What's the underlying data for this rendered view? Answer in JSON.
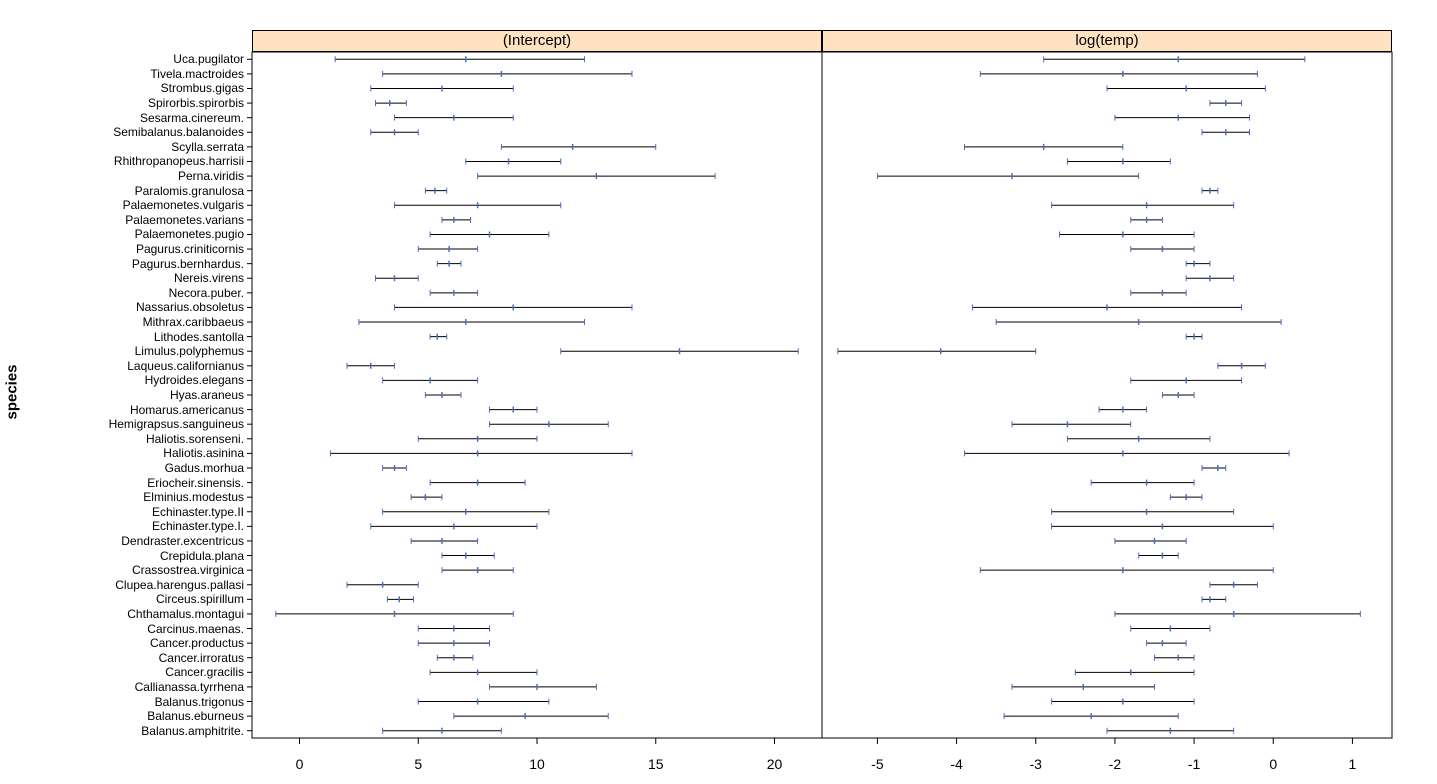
{
  "ylabel": "species",
  "chart_data": [
    {
      "type": "errorbar",
      "title": "(Intercept)",
      "xlabel": "",
      "ylabel": "species",
      "xlim": [
        -2,
        22
      ],
      "xticks": [
        0,
        5,
        10,
        15,
        20
      ],
      "categories": [
        "Uca.pugilator",
        "Tivela.mactroides",
        "Strombus.gigas",
        "Spirorbis.spirorbis",
        "Sesarma.cinereum.",
        "Semibalanus.balanoides",
        "Scylla.serrata",
        "Rhithropanopeus.harrisii",
        "Perna.viridis",
        "Paralomis.granulosa",
        "Palaemonetes.vulgaris",
        "Palaemonetes.varians",
        "Palaemonetes.pugio",
        "Pagurus.criniticornis",
        "Pagurus.bernhardus.",
        "Nereis.virens",
        "Necora.puber.",
        "Nassarius.obsoletus",
        "Mithrax.caribbaeus",
        "Lithodes.santolla",
        "Limulus.polyphemus",
        "Laqueus.californianus",
        "Hydroides.elegans",
        "Hyas.araneus",
        "Homarus.americanus",
        "Hemigrapsus.sanguineus",
        "Haliotis.sorenseni.",
        "Haliotis.asinina",
        "Gadus.morhua",
        "Eriocheir.sinensis.",
        "Elminius.modestus",
        "Echinaster.type.II",
        "Echinaster.type.I.",
        "Dendraster.excentricus",
        "Crepidula.plana",
        "Crassostrea.virginica",
        "Clupea.harengus.pallasi",
        "Circeus.spirillum",
        "Chthamalus.montagui",
        "Carcinus.maenas.",
        "Cancer.productus",
        "Cancer.irroratus",
        "Cancer.gracilis",
        "Callianassa.tyrrhena",
        "Balanus.trigonus",
        "Balanus.eburneus",
        "Balanus.amphitrite."
      ],
      "series": [
        {
          "name": "estimate",
          "lower": [
            1.5,
            3.5,
            3.0,
            3.2,
            4.0,
            3.0,
            8.5,
            7.0,
            7.5,
            5.3,
            4.0,
            6.0,
            5.5,
            5.0,
            5.8,
            3.2,
            5.5,
            4.0,
            2.5,
            5.5,
            11.0,
            2.0,
            3.5,
            5.3,
            8.0,
            8.0,
            5.0,
            1.3,
            3.5,
            5.5,
            4.7,
            3.5,
            3.0,
            4.7,
            6.0,
            6.0,
            2.0,
            3.7,
            -1.0,
            5.0,
            5.0,
            5.8,
            5.5,
            8.0,
            5.0,
            6.5,
            3.5
          ],
          "point": [
            7.0,
            8.5,
            6.0,
            3.8,
            6.5,
            4.0,
            11.5,
            8.8,
            12.5,
            5.7,
            7.5,
            6.5,
            8.0,
            6.3,
            6.3,
            4.0,
            6.5,
            9.0,
            7.0,
            5.8,
            16.0,
            3.0,
            5.5,
            6.0,
            9.0,
            10.5,
            7.5,
            7.5,
            4.0,
            7.5,
            5.3,
            7.0,
            6.5,
            6.0,
            7.0,
            7.5,
            3.5,
            4.2,
            4.0,
            6.5,
            6.5,
            6.5,
            7.5,
            10.0,
            7.5,
            9.5,
            6.0
          ],
          "upper": [
            12.0,
            14.0,
            9.0,
            4.5,
            9.0,
            5.0,
            15.0,
            11.0,
            17.5,
            6.2,
            11.0,
            7.2,
            10.5,
            7.5,
            6.8,
            5.0,
            7.5,
            14.0,
            12.0,
            6.2,
            21.0,
            4.0,
            7.5,
            6.8,
            10.0,
            13.0,
            10.0,
            14.0,
            4.5,
            9.5,
            6.0,
            10.5,
            10.0,
            7.5,
            8.2,
            9.0,
            5.0,
            4.8,
            9.0,
            8.0,
            8.0,
            7.3,
            10.0,
            12.5,
            10.5,
            13.0,
            8.5
          ]
        }
      ]
    },
    {
      "type": "errorbar",
      "title": "log(temp)",
      "xlabel": "",
      "ylabel": "species",
      "xlim": [
        -5.7,
        1.5
      ],
      "xticks": [
        -5,
        -4,
        -3,
        -2,
        -1,
        0,
        1
      ],
      "categories": "shared",
      "series": [
        {
          "name": "estimate",
          "lower": [
            -2.9,
            -3.7,
            -2.1,
            -0.8,
            -2.0,
            -0.9,
            -3.9,
            -2.6,
            -5.0,
            -0.9,
            -2.8,
            -1.8,
            -2.7,
            -1.8,
            -1.1,
            -1.1,
            -1.8,
            -3.8,
            -3.5,
            -1.1,
            -5.5,
            -0.7,
            -1.8,
            -1.4,
            -2.2,
            -3.3,
            -2.6,
            -3.9,
            -0.9,
            -2.3,
            -1.3,
            -2.8,
            -2.8,
            -2.0,
            -1.7,
            -3.7,
            -0.8,
            -0.9,
            -2.0,
            -1.8,
            -1.6,
            -1.5,
            -2.5,
            -3.3,
            -2.8,
            -3.4,
            -2.1
          ],
          "point": [
            -1.2,
            -1.9,
            -1.1,
            -0.6,
            -1.2,
            -0.6,
            -2.9,
            -1.9,
            -3.3,
            -0.8,
            -1.6,
            -1.6,
            -1.9,
            -1.4,
            -1.0,
            -0.8,
            -1.4,
            -2.1,
            -1.7,
            -1.0,
            -4.2,
            -0.4,
            -1.1,
            -1.2,
            -1.9,
            -2.6,
            -1.7,
            -1.9,
            -0.7,
            -1.6,
            -1.1,
            -1.6,
            -1.4,
            -1.5,
            -1.4,
            -1.9,
            -0.5,
            -0.8,
            -0.5,
            -1.3,
            -1.4,
            -1.2,
            -1.8,
            -2.4,
            -1.9,
            -2.3,
            -1.3
          ],
          "upper": [
            0.4,
            -0.2,
            -0.1,
            -0.4,
            -0.3,
            -0.3,
            -1.9,
            -1.3,
            -1.7,
            -0.7,
            -0.5,
            -1.4,
            -1.0,
            -1.0,
            -0.8,
            -0.5,
            -1.1,
            -0.4,
            0.1,
            -0.9,
            -3.0,
            -0.1,
            -0.4,
            -1.0,
            -1.6,
            -1.8,
            -0.8,
            0.2,
            -0.6,
            -1.0,
            -0.9,
            -0.5,
            0.0,
            -1.1,
            -1.2,
            0.0,
            -0.2,
            -0.6,
            1.1,
            -0.8,
            -1.1,
            -1.0,
            -1.0,
            -1.5,
            -1.0,
            -1.2,
            -0.5
          ]
        }
      ]
    }
  ]
}
